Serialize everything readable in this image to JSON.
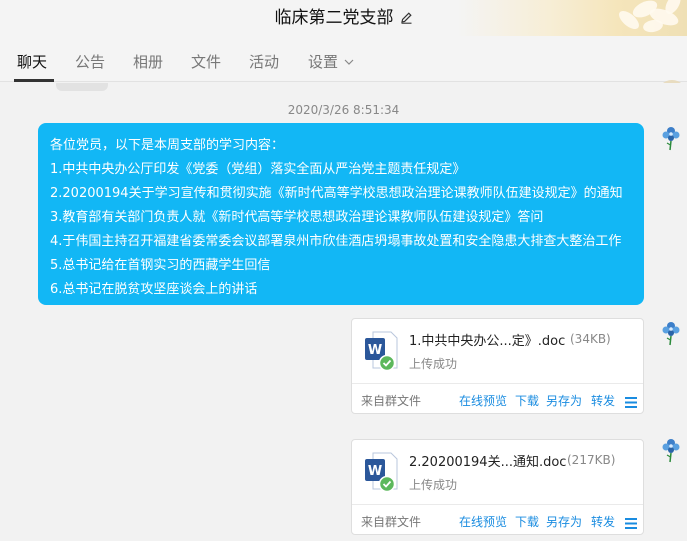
{
  "header": {
    "title": "临床第二党支部"
  },
  "tabs": [
    {
      "label": "聊天",
      "active": true
    },
    {
      "label": "公告"
    },
    {
      "label": "相册"
    },
    {
      "label": "文件"
    },
    {
      "label": "活动"
    },
    {
      "label": "设置"
    }
  ],
  "chat": {
    "timestamp": "2020/3/26 8:51:34",
    "message_lines": [
      "各位党员，以下是本周支部的学习内容：",
      "1.中共中央办公厅印发《党委（党组）落实全面从严治党主题责任规定》",
      "2.20200194关于学习宣传和贯彻实施《新时代高等学校思想政治理论课教师队伍建设规定》的通知",
      "3.教育部有关部门负责人就《新时代高等学校思想政治理论课教师队伍建设规定》答问",
      "4.于伟国主持召开福建省委常委会议部署泉州市欣佳酒店坍塌事故处置和安全隐患大排查大整治工作",
      "5.总书记给在首钢实习的西藏学生回信",
      "6.总书记在脱贫攻坚座谈会上的讲话"
    ],
    "files": [
      {
        "name": "1.中共中央办公...定》.doc",
        "size": "(34KB)",
        "status": "上传成功",
        "source": "来自群文件",
        "actions": [
          "在线预览",
          "下载",
          "另存为",
          "转发"
        ]
      },
      {
        "name": "2.20200194关...通知.doc",
        "size": "(217KB)",
        "status": "上传成功",
        "source": "来自群文件",
        "actions": [
          "在线预览",
          "下载",
          "另存为",
          "转发"
        ]
      }
    ]
  },
  "icons": {
    "edit": "pencil-icon",
    "settings_dropdown": "chevron-down-icon",
    "call": "phone-icon",
    "file_type": "word-doc-icon",
    "upload_ok": "check-circle-icon",
    "more": "menu-icon",
    "avatar": "blue-flower-avatar-icon"
  },
  "colors": {
    "bubble": "#12b7f5",
    "link": "#1a8ce0",
    "word_blue": "#2b579a",
    "success_green": "#5cb85c"
  }
}
